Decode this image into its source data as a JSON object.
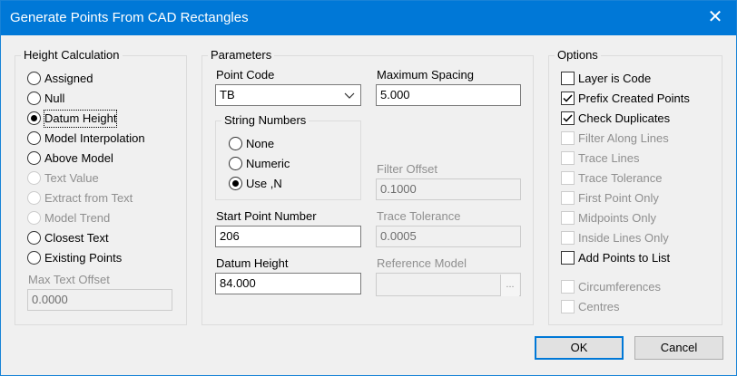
{
  "window": {
    "title": "Generate Points From CAD Rectangles",
    "close_glyph": "✕"
  },
  "height_calculation": {
    "title": "Height Calculation",
    "options": [
      {
        "label": "Assigned",
        "checked": false,
        "enabled": true
      },
      {
        "label": "Null",
        "checked": false,
        "enabled": true
      },
      {
        "label": "Datum Height",
        "checked": true,
        "enabled": true
      },
      {
        "label": "Model Interpolation",
        "checked": false,
        "enabled": true
      },
      {
        "label": "Above Model",
        "checked": false,
        "enabled": true
      },
      {
        "label": "Text Value",
        "checked": false,
        "enabled": false
      },
      {
        "label": "Extract from Text",
        "checked": false,
        "enabled": false
      },
      {
        "label": "Model Trend",
        "checked": false,
        "enabled": false
      },
      {
        "label": "Closest Text",
        "checked": false,
        "enabled": true
      },
      {
        "label": "Existing Points",
        "checked": false,
        "enabled": true
      }
    ],
    "max_text_offset": {
      "label": "Max Text Offset",
      "value": "0.0000",
      "enabled": false
    }
  },
  "parameters": {
    "title": "Parameters",
    "point_code": {
      "label": "Point Code",
      "value": "TB"
    },
    "maximum_spacing": {
      "label": "Maximum Spacing",
      "value": "5.000"
    },
    "string_numbers": {
      "title": "String Numbers",
      "options": [
        {
          "label": "None",
          "checked": false
        },
        {
          "label": "Numeric",
          "checked": false
        },
        {
          "label": "Use ,N",
          "checked": true
        }
      ]
    },
    "filter_offset": {
      "label": "Filter Offset",
      "value": "0.1000",
      "enabled": false
    },
    "start_point_number": {
      "label": "Start Point Number",
      "value": "206"
    },
    "trace_tolerance": {
      "label": "Trace Tolerance",
      "value": "0.0005",
      "enabled": false
    },
    "datum_height": {
      "label": "Datum Height",
      "value": "84.000"
    },
    "reference_model": {
      "label": "Reference Model",
      "value": "",
      "enabled": false,
      "browse_label": "..."
    }
  },
  "options": {
    "title": "Options",
    "items": [
      {
        "label": "Layer is Code",
        "checked": false,
        "enabled": true
      },
      {
        "label": "Prefix Created Points",
        "checked": true,
        "enabled": true
      },
      {
        "label": "Check Duplicates",
        "checked": true,
        "enabled": true
      },
      {
        "label": "Filter Along Lines",
        "checked": false,
        "enabled": false
      },
      {
        "label": "Trace Lines",
        "checked": false,
        "enabled": false
      },
      {
        "label": "Trace Tolerance",
        "checked": false,
        "enabled": false
      },
      {
        "label": "First Point Only",
        "checked": false,
        "enabled": false
      },
      {
        "label": "Midpoints Only",
        "checked": false,
        "enabled": false
      },
      {
        "label": "Inside Lines Only",
        "checked": false,
        "enabled": false
      },
      {
        "label": "Add Points to List",
        "checked": false,
        "enabled": true
      },
      {
        "label": "Circumferences",
        "checked": false,
        "enabled": false
      },
      {
        "label": "Centres",
        "checked": false,
        "enabled": false
      }
    ]
  },
  "buttons": {
    "ok": "OK",
    "cancel": "Cancel"
  }
}
